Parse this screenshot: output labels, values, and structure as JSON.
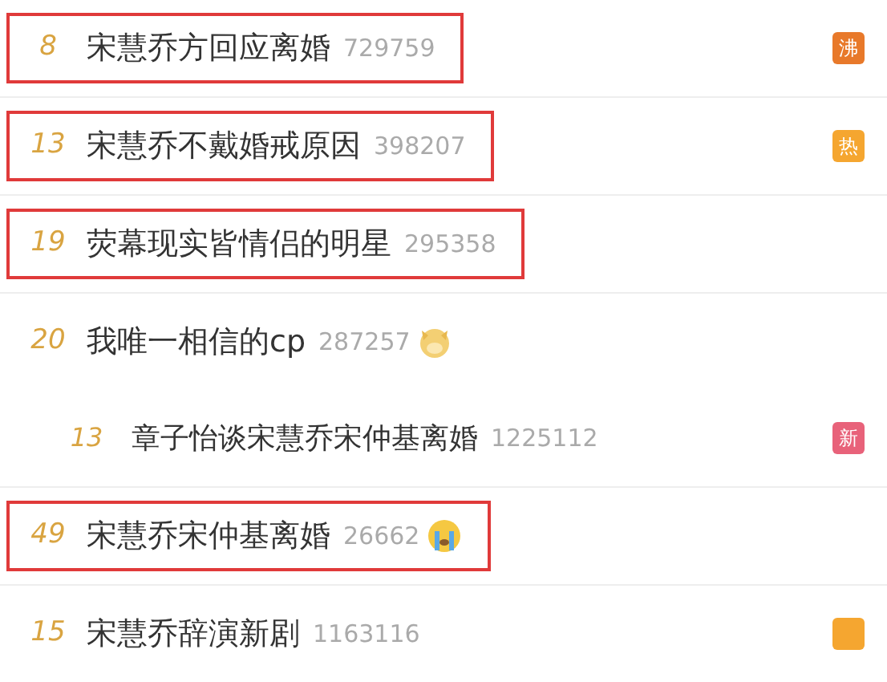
{
  "rows": [
    {
      "rank": "8",
      "title": "宋慧乔方回应离婚",
      "count": "729759",
      "highlighted": true,
      "kind": "main",
      "badge": {
        "label": "沸",
        "color": "#e8792a"
      }
    },
    {
      "rank": "13",
      "title": "宋慧乔不戴婚戒原因",
      "count": "398207",
      "highlighted": true,
      "kind": "main",
      "badge": {
        "label": "热",
        "color": "#f5a630"
      }
    },
    {
      "rank": "19",
      "title": "荧幕现实皆情侣的明星",
      "count": "295358",
      "highlighted": true,
      "kind": "main"
    },
    {
      "rank": "20",
      "title": "我唯一相信的cp",
      "count": "287257",
      "highlighted": false,
      "kind": "main",
      "emoji": {
        "kind": "doge"
      }
    },
    {
      "rank": "13",
      "title": "章子怡谈宋慧乔宋仲基离婚",
      "count": "1225112",
      "highlighted": false,
      "kind": "sub",
      "badge": {
        "label": "新",
        "color": "#e8627a"
      }
    },
    {
      "rank": "49",
      "title": "宋慧乔宋仲基离婚",
      "count": "26662",
      "highlighted": true,
      "kind": "main",
      "emoji": {
        "kind": "cry"
      }
    },
    {
      "rank": "15",
      "title": "宋慧乔辞演新剧",
      "count": "1163116",
      "highlighted": false,
      "kind": "main",
      "badge": {
        "color": "#f5a630"
      }
    }
  ]
}
